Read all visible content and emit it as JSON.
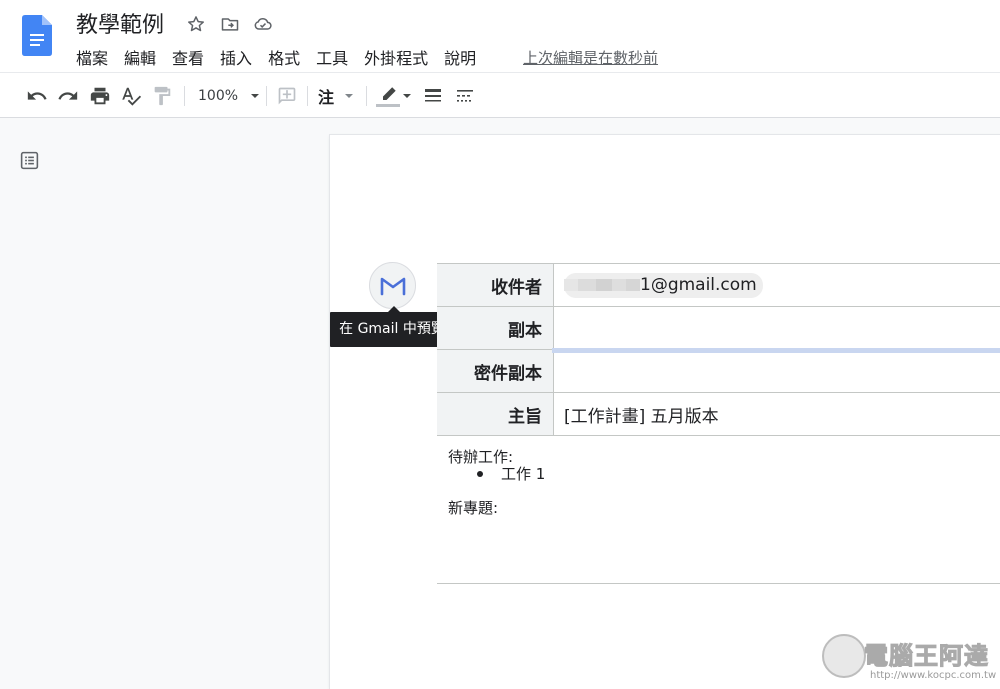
{
  "document": {
    "title": "教學範例",
    "last_edit": "上次編輯是在數秒前"
  },
  "menu": {
    "items": [
      "檔案",
      "編輯",
      "查看",
      "插入",
      "格式",
      "工具",
      "外掛程式",
      "說明"
    ]
  },
  "toolbar": {
    "zoom": "100%",
    "style": "注"
  },
  "gmail": {
    "tooltip": "在 Gmail 中預覽"
  },
  "email": {
    "rows": [
      {
        "label": "收件者",
        "value": "1@gmail.com"
      },
      {
        "label": "副本",
        "value": ""
      },
      {
        "label": "密件副本",
        "value": ""
      },
      {
        "label": "主旨",
        "value": "[工作計畫] 五月版本"
      }
    ]
  },
  "body": {
    "todo_heading": "待辦工作:",
    "todo_items": [
      "工作 1"
    ],
    "new_topic": "新專題:"
  },
  "watermark": {
    "text": "電腦王阿達",
    "url": "http://www.kocpc.com.tw"
  },
  "colors": {
    "docs_blue": "#4285f4",
    "gmail_icon": "#4a6fd8",
    "tooltip_bg": "#202124",
    "selection_blue": "#c9d6f0"
  },
  "icons": [
    "docs-logo",
    "star-icon",
    "move-to-folder-icon",
    "cloud-saved-icon",
    "undo-icon",
    "redo-icon",
    "print-icon",
    "spellcheck-icon",
    "paint-format-icon",
    "add-comment-icon",
    "highlight-color-icon",
    "line-spacing-icon",
    "menu-lines-icon",
    "outline-icon",
    "gmail-icon"
  ]
}
